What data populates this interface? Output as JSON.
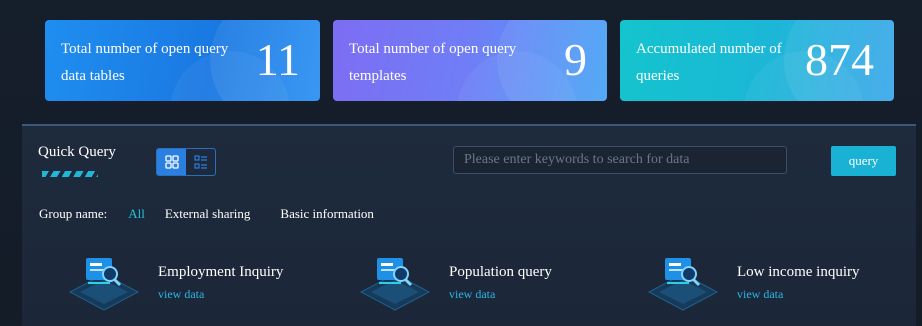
{
  "stats": [
    {
      "label": "Total number of open query data tables",
      "value": "11"
    },
    {
      "label": "Total number of open query templates",
      "value": "9"
    },
    {
      "label": "Accumulated number of queries",
      "value": "874"
    }
  ],
  "quick_query": {
    "title": "Quick Query",
    "search": {
      "placeholder": "Please enter keywords to search for data",
      "value": ""
    },
    "query_button": "query",
    "group_label": "Group name:",
    "groups": [
      "All",
      "External sharing",
      "Basic information"
    ],
    "active_group": "All",
    "items": [
      {
        "name": "Employment Inquiry",
        "link": "view data"
      },
      {
        "name": "Population query",
        "link": "view data"
      },
      {
        "name": "Low income inquiry",
        "link": "view data"
      }
    ]
  },
  "colors": {
    "accent": "#1fc3d8",
    "query_button": "#19b1d4",
    "background": "#141d2a"
  }
}
